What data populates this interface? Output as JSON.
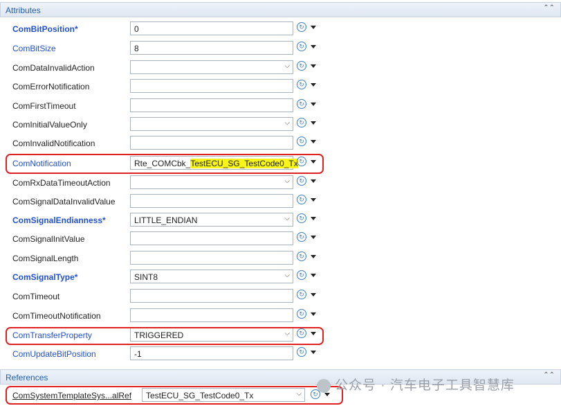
{
  "attributes": {
    "title": "Attributes",
    "rows": [
      {
        "label": "ComBitPosition*",
        "value": "0",
        "kind": "text",
        "blue": true,
        "bold": true
      },
      {
        "label": "ComBitSize",
        "value": "8",
        "kind": "text",
        "blue": true,
        "bold": false
      },
      {
        "label": "ComDataInvalidAction",
        "value": "",
        "kind": "select",
        "blue": false,
        "bold": false
      },
      {
        "label": "ComErrorNotification",
        "value": "",
        "kind": "text",
        "blue": false,
        "bold": false
      },
      {
        "label": "ComFirstTimeout",
        "value": "",
        "kind": "text",
        "blue": false,
        "bold": false
      },
      {
        "label": "ComInitialValueOnly",
        "value": "",
        "kind": "select",
        "blue": false,
        "bold": false
      },
      {
        "label": "ComInvalidNotification",
        "value": "",
        "kind": "text",
        "blue": false,
        "bold": false
      },
      {
        "label": "ComNotification",
        "value_prefix": "Rte_COMCbk_",
        "value_highlight": "TestECU_SG_TestCode0_Tx",
        "kind": "text",
        "blue": true,
        "bold": false
      },
      {
        "label": "ComRxDataTimeoutAction",
        "value": "",
        "kind": "select",
        "blue": false,
        "bold": false
      },
      {
        "label": "ComSignalDataInvalidValue",
        "value": "",
        "kind": "text",
        "blue": false,
        "bold": false
      },
      {
        "label": "ComSignalEndianness*",
        "value": "LITTLE_ENDIAN",
        "kind": "select",
        "blue": true,
        "bold": true
      },
      {
        "label": "ComSignalInitValue",
        "value": "",
        "kind": "text",
        "blue": false,
        "bold": false
      },
      {
        "label": "ComSignalLength",
        "value": "",
        "kind": "text",
        "blue": false,
        "bold": false
      },
      {
        "label": "ComSignalType*",
        "value": "SINT8",
        "kind": "select",
        "blue": true,
        "bold": true
      },
      {
        "label": "ComTimeout",
        "value": "",
        "kind": "text",
        "blue": false,
        "bold": false
      },
      {
        "label": "ComTimeoutNotification",
        "value": "",
        "kind": "text",
        "blue": false,
        "bold": false
      },
      {
        "label": "ComTransferProperty",
        "value": "TRIGGERED",
        "kind": "select",
        "blue": true,
        "bold": false
      },
      {
        "label": "ComUpdateBitPosition",
        "value": "-1",
        "kind": "text",
        "blue": true,
        "bold": false
      }
    ]
  },
  "references": {
    "title": "References",
    "rows": [
      {
        "label": "ComSystemTemplateSys...alRef",
        "value": "TestECU_SG_TestCode0_Tx",
        "kind": "select"
      }
    ]
  },
  "watermark": "公众号 · 汽车电子工具智慧库",
  "icons": {
    "collapse": "double-chevron-up-icon",
    "reset": "reset-circle-icon",
    "menu": "dropdown-triangle-icon"
  },
  "colors": {
    "highlight_box": "#e02020",
    "link_blue": "#1f4fd6",
    "text_highlight": "#f7f51a"
  }
}
